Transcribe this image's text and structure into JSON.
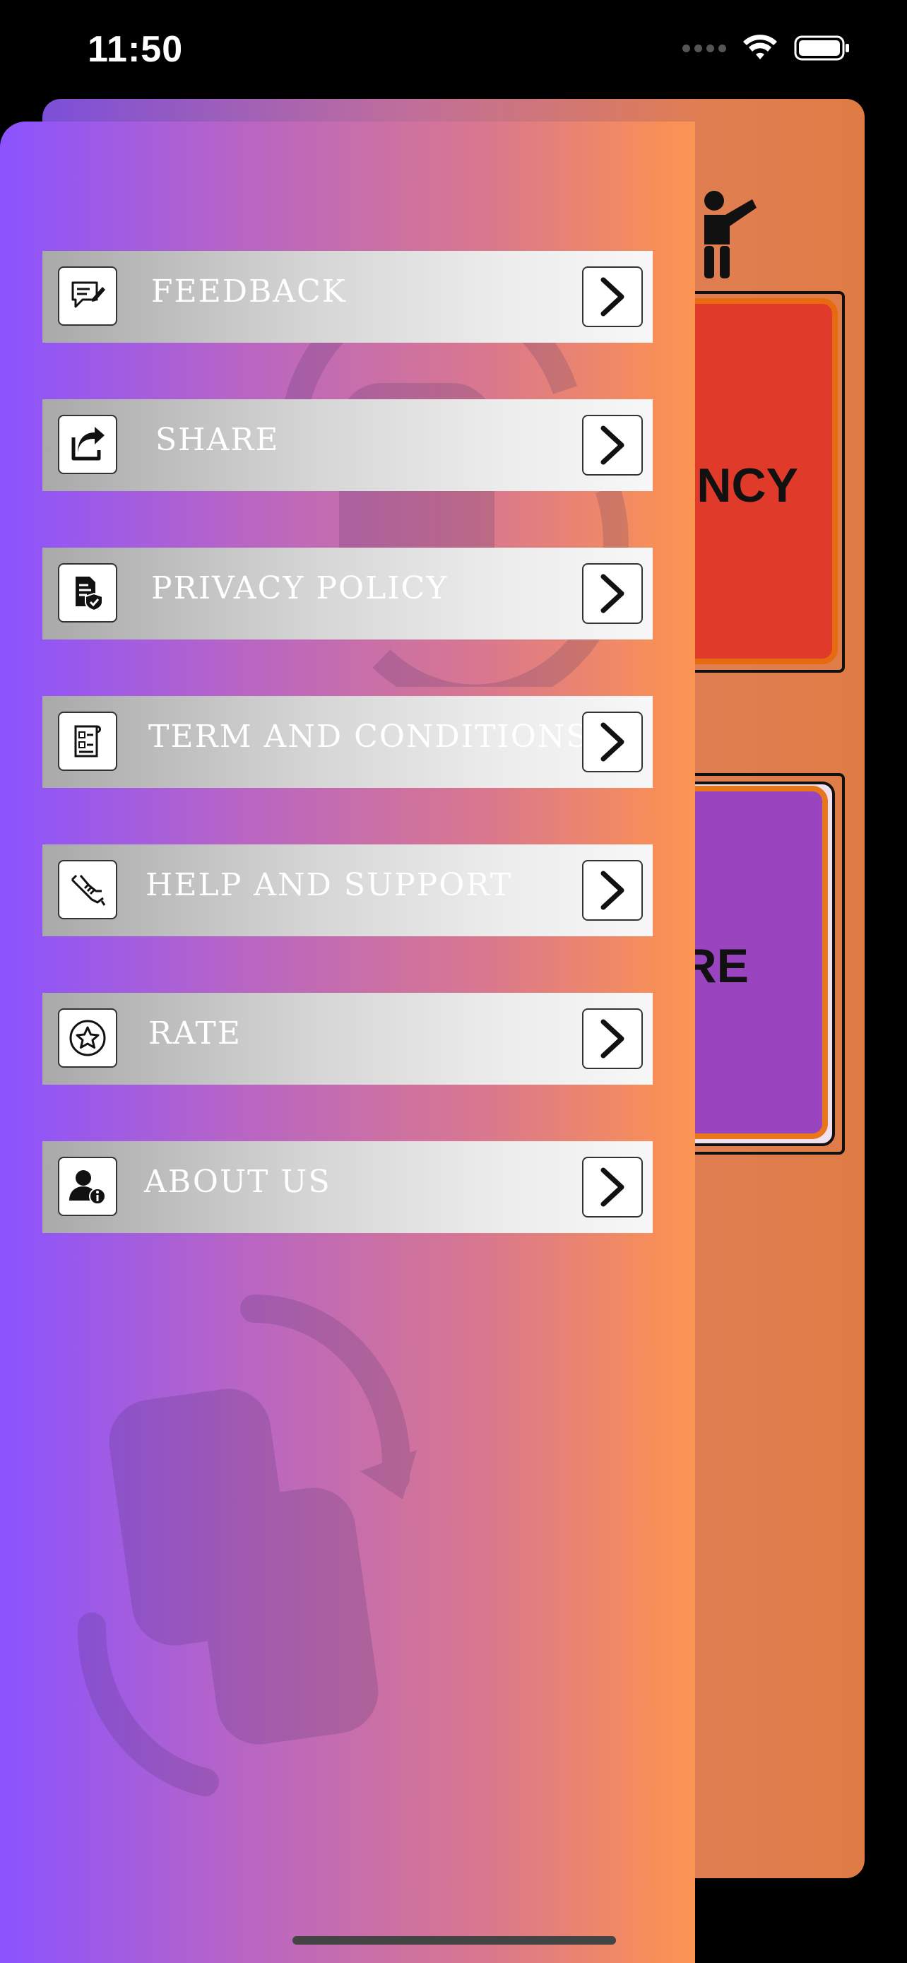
{
  "status_bar": {
    "time": "11:50"
  },
  "background": {
    "emergency_label": "ENCY",
    "share_label": "RE",
    "colors": {
      "emergency": "#e03a2a",
      "share": "#9b44c0",
      "border": "#e86a10"
    }
  },
  "drawer": {
    "colors": {
      "gradient_start": "#8b53ff",
      "gradient_end": "#fc9453"
    },
    "menu": [
      {
        "label": "FEEDBACK",
        "icon": "feedback-icon"
      },
      {
        "label": "SHARE",
        "icon": "share-icon"
      },
      {
        "label": "PRIVACY POLICY",
        "icon": "privacy-policy-icon"
      },
      {
        "label": "TERM AND CONDITIONS",
        "icon": "terms-icon"
      },
      {
        "label": "HELP AND SUPPORT",
        "icon": "help-support-icon"
      },
      {
        "label": "RATE",
        "icon": "rate-star-icon"
      },
      {
        "label": "ABOUT US",
        "icon": "about-us-icon"
      }
    ]
  }
}
